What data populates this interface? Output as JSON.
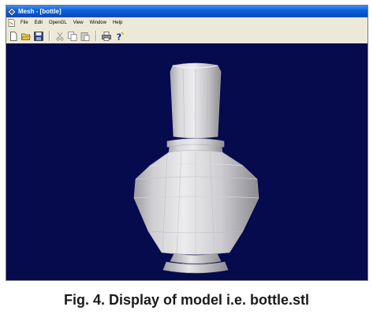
{
  "window": {
    "title": "Mesh - [bottle]"
  },
  "menu": {
    "items": [
      "File",
      "Edit",
      "OpenGL",
      "View",
      "Window",
      "Help"
    ]
  },
  "toolbar": {
    "buttons": [
      "new-icon",
      "open-icon",
      "save-icon",
      "cut-icon",
      "copy-icon",
      "paste-icon",
      "print-icon",
      "help-icon"
    ]
  },
  "viewport": {
    "background": "#050b4d",
    "model_color": "#c8c8cc"
  },
  "caption": {
    "text": "Fig. 4. Display of model i.e. bottle.stl"
  }
}
